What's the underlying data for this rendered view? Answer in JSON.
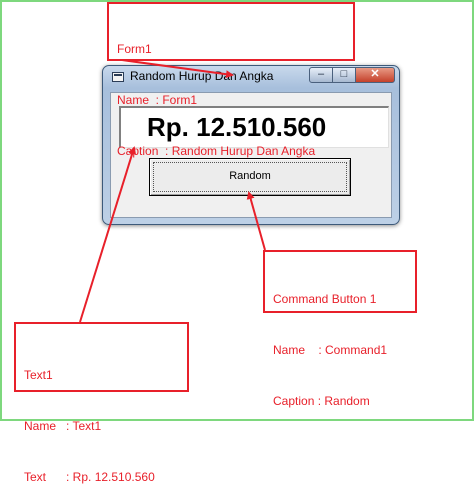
{
  "window": {
    "title": "Random Hurup Dan Angka",
    "text_value": "Rp. 12.510.560",
    "button_label": "Random",
    "controls": {
      "minimize": "–",
      "maximize": "□",
      "close": "✕"
    }
  },
  "callouts": {
    "form": {
      "line1": "Form1",
      "line2": "Name  : Form1",
      "line3": "Caption  : Random Hurup Dan Angka"
    },
    "command": {
      "line1": "Command Button 1",
      "line2": "Name    : Command1",
      "line3": "Caption : Random"
    },
    "text": {
      "line1": "Text1",
      "line2": "Name   : Text1",
      "line3": "Text      : Rp. 12.510.560"
    }
  },
  "colors": {
    "annotation": "#e8202a",
    "frame": "#7ed87e"
  }
}
